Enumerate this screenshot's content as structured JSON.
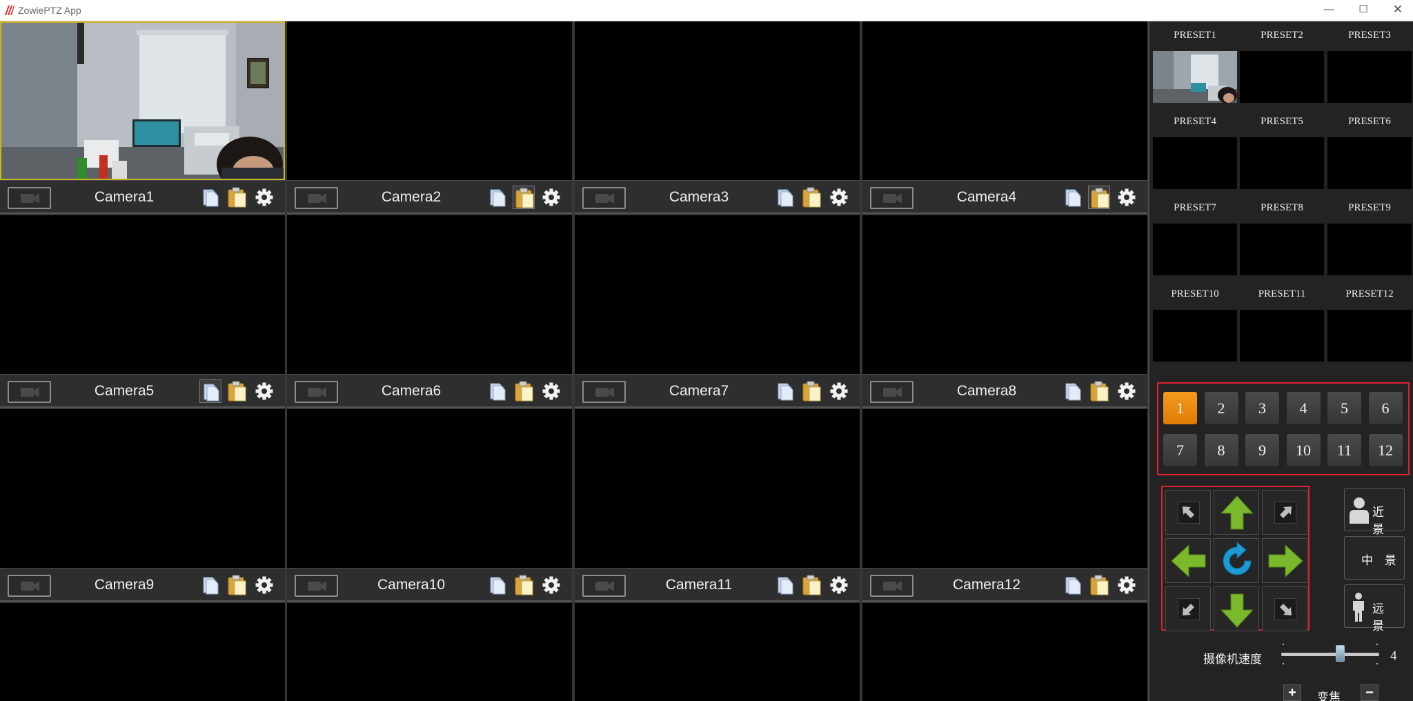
{
  "window": {
    "title": "ZowiePTZ App",
    "minimize_glyph": "—",
    "maximize_glyph": "☐",
    "close_glyph": "✕"
  },
  "cameras": [
    {
      "name": "Camera1"
    },
    {
      "name": "Camera2"
    },
    {
      "name": "Camera3"
    },
    {
      "name": "Camera4"
    },
    {
      "name": "Camera5"
    },
    {
      "name": "Camera6"
    },
    {
      "name": "Camera7"
    },
    {
      "name": "Camera8"
    },
    {
      "name": "Camera9"
    },
    {
      "name": "Camera10"
    },
    {
      "name": "Camera11"
    },
    {
      "name": "Camera12"
    }
  ],
  "active_camera": "Camera1",
  "presets": [
    {
      "label": "PRESET1"
    },
    {
      "label": "PRESET2"
    },
    {
      "label": "PRESET3"
    },
    {
      "label": "PRESET4"
    },
    {
      "label": "PRESET5"
    },
    {
      "label": "PRESET6"
    },
    {
      "label": "PRESET7"
    },
    {
      "label": "PRESET8"
    },
    {
      "label": "PRESET9"
    },
    {
      "label": "PRESET10"
    },
    {
      "label": "PRESET11"
    },
    {
      "label": "PRESET12"
    }
  ],
  "camera_select": {
    "buttons": [
      "1",
      "2",
      "3",
      "4",
      "5",
      "6",
      "7",
      "8",
      "9",
      "10",
      "11",
      "12"
    ],
    "selected": "1"
  },
  "scenes": {
    "close_up": "近 景",
    "medium": "中 景",
    "long": "远 景"
  },
  "speed": {
    "label": "摄像机速度",
    "value": "4",
    "fraction": 0.6
  },
  "zoom": {
    "label": "变焦",
    "plus": "+",
    "minus": "−"
  },
  "colors": {
    "active_button": "#f08a12",
    "highlight_border": "#e0202e",
    "arrow_green": "#7cb82c",
    "refresh_blue": "#1d9ad6"
  },
  "icons": {
    "camera_toggle": "video-camera-icon",
    "copy": "copy-icon",
    "paste": "paste-icon",
    "settings": "gear-icon"
  }
}
